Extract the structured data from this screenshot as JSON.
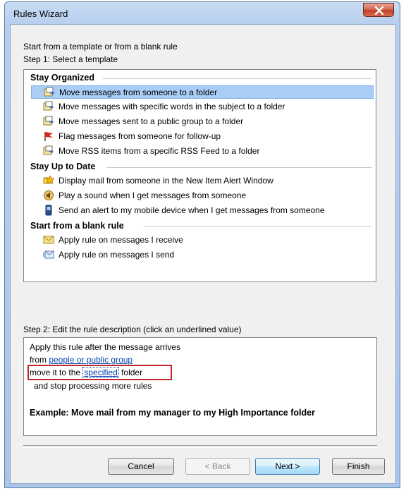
{
  "window": {
    "title": "Rules Wizard"
  },
  "intro": {
    "line1": "Start from a template or from a blank rule",
    "step1": "Step 1: Select a template"
  },
  "groups": [
    {
      "title": "Stay Organized"
    },
    {
      "title": "Stay Up to Date"
    },
    {
      "title": "Start from a blank rule"
    }
  ],
  "items": [
    {
      "label": "Move messages from someone to a folder",
      "icon": "move-to-folder-icon",
      "selected": true
    },
    {
      "label": "Move messages with specific words in the subject to a folder",
      "icon": "move-to-folder-icon"
    },
    {
      "label": "Move messages sent to a public group to a folder",
      "icon": "move-to-folder-icon"
    },
    {
      "label": "Flag messages from someone for follow-up",
      "icon": "flag-icon"
    },
    {
      "label": "Move RSS items from a specific RSS Feed to a folder",
      "icon": "move-to-folder-icon"
    },
    {
      "label": "Display mail from someone in the New Item Alert Window",
      "icon": "alert-window-icon"
    },
    {
      "label": "Play a sound when I get messages from someone",
      "icon": "speaker-icon"
    },
    {
      "label": "Send an alert to my mobile device when I get messages from someone",
      "icon": "mobile-phone-icon"
    },
    {
      "label": "Apply rule on messages I receive",
      "icon": "envelope-icon"
    },
    {
      "label": "Apply rule on messages I send",
      "icon": "outbox-icon"
    }
  ],
  "step2": {
    "label": "Step 2: Edit the rule description (click an underlined value)",
    "line1": "Apply this rule after the message arrives",
    "line2_prefix": "from ",
    "line2_link": "people or public group",
    "line3_prefix": "move it to the ",
    "line3_link": "specified",
    "line3_suffix": " folder",
    "line4": "and stop processing more rules",
    "example": "Example: Move mail from my manager to my High Importance folder"
  },
  "buttons": {
    "cancel": "Cancel",
    "back": "< Back",
    "next": "Next >",
    "finish": "Finish"
  },
  "colors": {
    "selection": "#a9cdf5",
    "link": "#0645ad",
    "highlight_box": "#c0262c",
    "close": "#c1402a"
  }
}
